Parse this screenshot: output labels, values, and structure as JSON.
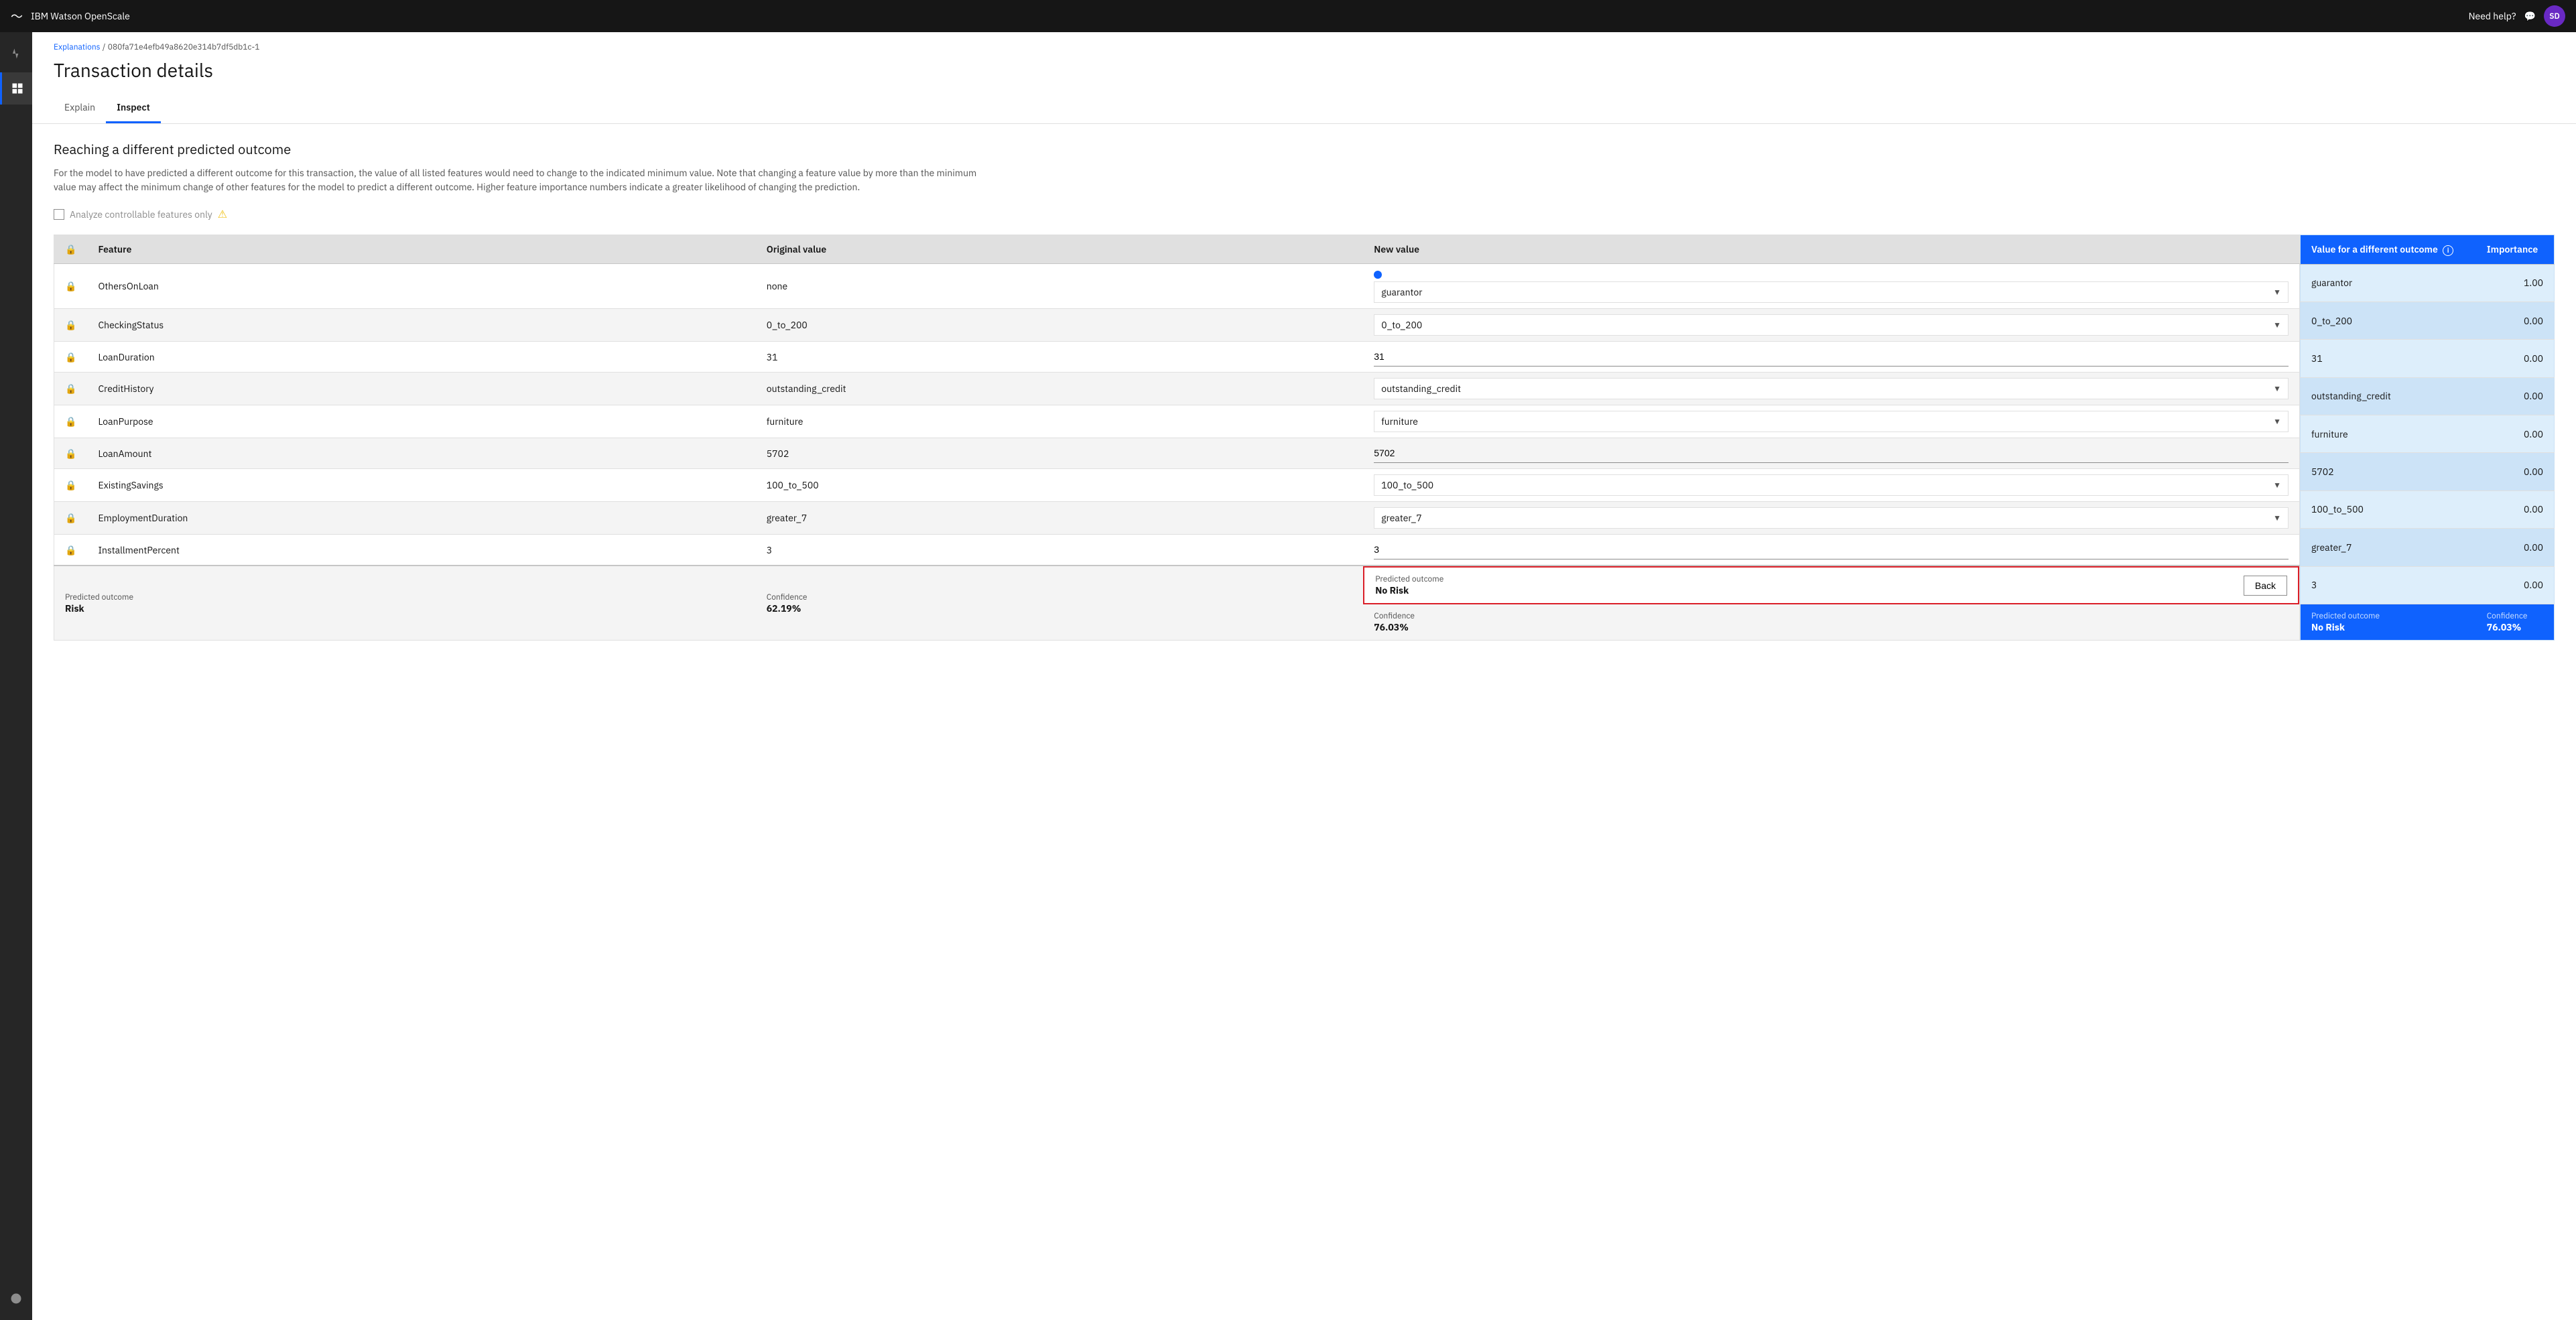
{
  "topNav": {
    "brand": "IBM Watson OpenScale",
    "helpLabel": "Need help?",
    "userInitials": "SD"
  },
  "breadcrumb": {
    "linkText": "Explanations",
    "separator": "/",
    "currentPath": "080fa71e4efb49a8620e314b7df5db1c-1"
  },
  "pageTitle": "Transaction details",
  "tabs": [
    {
      "label": "Explain",
      "active": false
    },
    {
      "label": "Inspect",
      "active": true
    }
  ],
  "section": {
    "title": "Reaching a different predicted outcome",
    "description": "For the model to have predicted a different outcome for this transaction, the value of all listed features would need to change to the indicated minimum value. Note that changing a feature value by more than the minimum value may affect the minimum change of other features for the model to predict a different outcome. Higher feature importance numbers indicate a greater likelihood of changing the prediction."
  },
  "checkbox": {
    "label": "Analyze controllable features only"
  },
  "tableHeaders": {
    "feature": "Feature",
    "originalValue": "Original value",
    "newValue": "New value",
    "valueForDifferentOutcome": "Value for a different outcome",
    "importance": "Importance"
  },
  "tableRows": [
    {
      "feature": "OthersOnLoan",
      "originalValue": "none",
      "newValue": "guarantor",
      "hasDropdown": true,
      "hasDot": true,
      "outcomeValue": "guarantor",
      "importance": "1.00"
    },
    {
      "feature": "CheckingStatus",
      "originalValue": "0_to_200",
      "newValue": "0_to_200",
      "hasDropdown": true,
      "hasDot": false,
      "outcomeValue": "0_to_200",
      "importance": "0.00"
    },
    {
      "feature": "LoanDuration",
      "originalValue": "31",
      "newValue": "31",
      "hasDropdown": false,
      "hasDot": false,
      "outcomeValue": "31",
      "importance": "0.00"
    },
    {
      "feature": "CreditHistory",
      "originalValue": "outstanding_credit",
      "newValue": "outstanding_credit",
      "hasDropdown": true,
      "hasDot": false,
      "outcomeValue": "outstanding_credit",
      "importance": "0.00"
    },
    {
      "feature": "LoanPurpose",
      "originalValue": "furniture",
      "newValue": "furniture",
      "hasDropdown": true,
      "hasDot": false,
      "outcomeValue": "furniture",
      "importance": "0.00"
    },
    {
      "feature": "LoanAmount",
      "originalValue": "5702",
      "newValue": "5702",
      "hasDropdown": false,
      "hasDot": false,
      "outcomeValue": "5702",
      "importance": "0.00"
    },
    {
      "feature": "ExistingSavings",
      "originalValue": "100_to_500",
      "newValue": "100_to_500",
      "hasDropdown": true,
      "hasDot": false,
      "outcomeValue": "100_to_500",
      "importance": "0.00"
    },
    {
      "feature": "EmploymentDuration",
      "originalValue": "greater_7",
      "newValue": "greater_7",
      "hasDropdown": true,
      "hasDot": false,
      "outcomeValue": "greater_7",
      "importance": "0.00"
    },
    {
      "feature": "InstallmentPercent",
      "originalValue": "3",
      "newValue": "3",
      "hasDropdown": false,
      "hasDot": false,
      "outcomeValue": "3",
      "importance": "0.00"
    }
  ],
  "bottomBar": {
    "originalPredictedLabel": "Predicted outcome",
    "originalPredictedValue": "Risk",
    "originalConfidenceLabel": "Confidence",
    "originalConfidenceValue": "62.19%",
    "newPredictedLabel": "Predicted outcome",
    "newPredictedValue": "No Risk",
    "newConfidenceLabel": "Confidence",
    "newConfidenceValue": "76.03%",
    "outcomePredictedLabel": "Predicted outcome",
    "outcomePredictedValue": "No Risk",
    "outcomeConfidenceLabel": "Confidence",
    "outcomeConfidenceValue": "76.03%",
    "backButtonLabel": "Back"
  }
}
